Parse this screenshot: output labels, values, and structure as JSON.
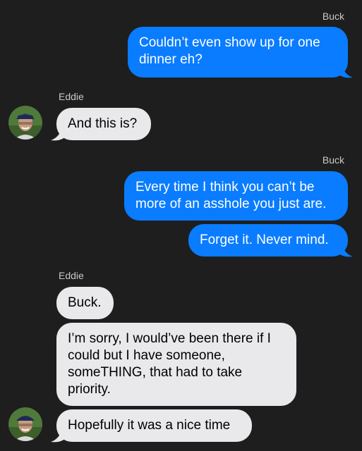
{
  "colors": {
    "background": "#1e1e1e",
    "outgoing_bubble": "#0a7cff",
    "incoming_bubble": "#e9e9eb"
  },
  "conversation": {
    "groups": [
      {
        "sender": "Buck",
        "direction": "outgoing",
        "messages": [
          "Couldn’t even show up for one dinner eh?"
        ]
      },
      {
        "sender": "Eddie",
        "direction": "incoming",
        "avatar_icon": "contact-photo",
        "messages": [
          "And this is?"
        ]
      },
      {
        "sender": "Buck",
        "direction": "outgoing",
        "messages": [
          "Every time I think you can’t be more of an asshole you just are.",
          "Forget it. Never mind."
        ]
      },
      {
        "sender": "Eddie",
        "direction": "incoming",
        "avatar_icon": "contact-photo",
        "messages": [
          "Buck.",
          "I’m sorry, I would’ve been there if I could but I have someone, someTHING, that had to take priority.",
          "Hopefully it was a nice time"
        ]
      }
    ]
  }
}
